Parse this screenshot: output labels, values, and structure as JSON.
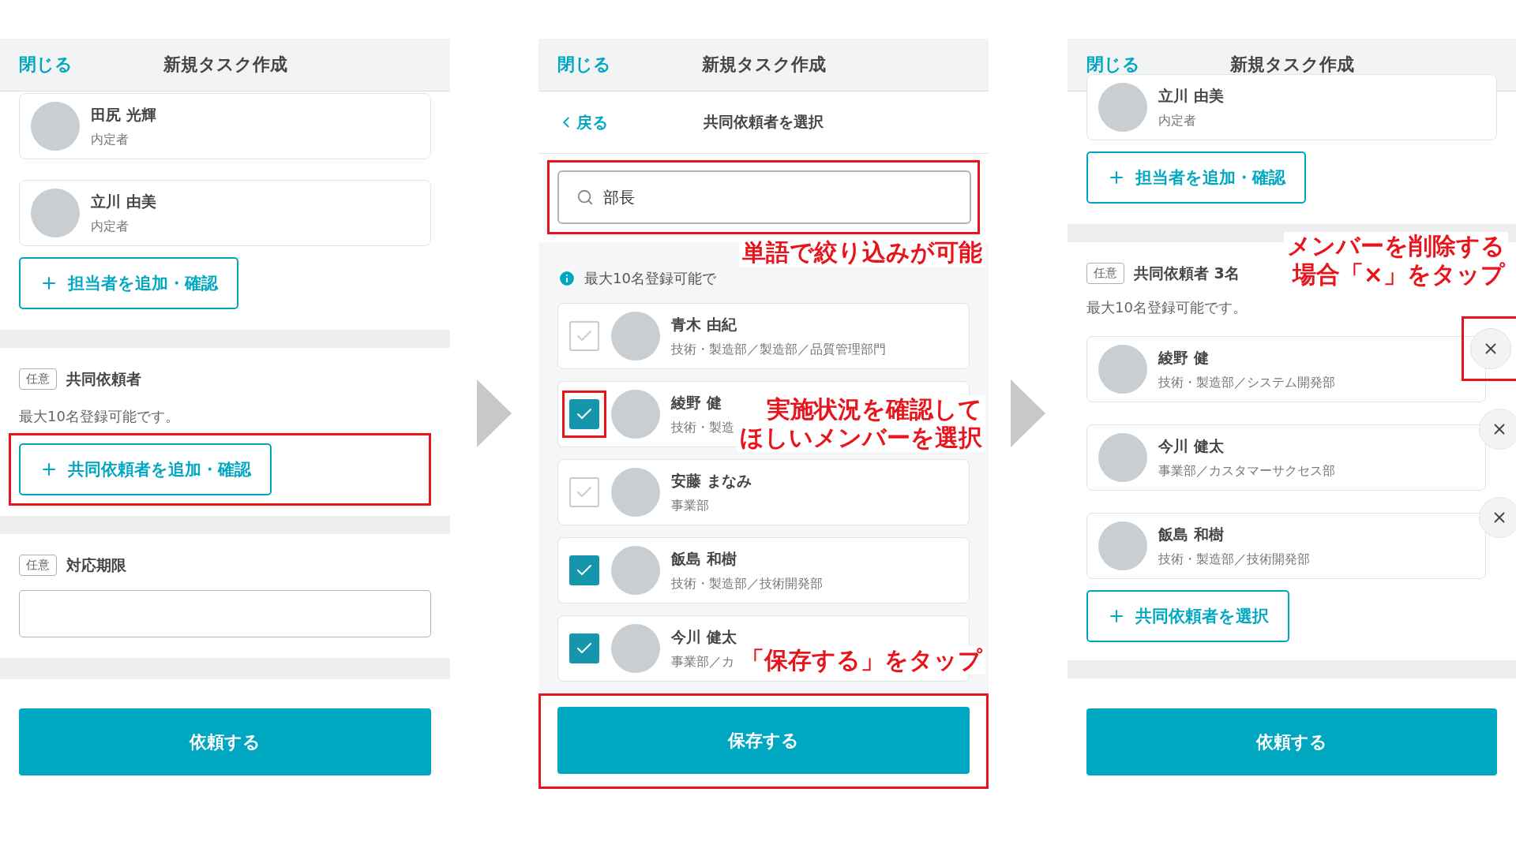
{
  "screens": [
    {
      "kind": "form",
      "header": {
        "close": "閉じる",
        "title": "新規タスク作成"
      },
      "assignees": [
        {
          "name": "田尻 光輝",
          "role": "内定者"
        },
        {
          "name": "立川 由美",
          "role": "内定者"
        }
      ],
      "add_assignee": {
        "label": "担当者を追加・確認"
      },
      "co_requesters": {
        "tag": "任意",
        "title": "共同依頼者",
        "note": "最大10名登録可能です。",
        "add_button": {
          "label": "共同依頼者を追加・確認",
          "highlighted": true
        }
      },
      "deadline": {
        "tag": "任意",
        "title": "対応期限"
      },
      "submit": {
        "label": "依頼する"
      }
    },
    {
      "kind": "picker",
      "header": {
        "close": "閉じる",
        "title": "新規タスク作成"
      },
      "back": "戻る",
      "subtitle": "共同依頼者を選択",
      "search": {
        "value": "部長",
        "highlighted": true
      },
      "info": "最大10名登録可能で",
      "candidates": [
        {
          "name": "青木 由紀",
          "dept": "技術・製造部／製造部／品質管理部門",
          "checked": false,
          "highlighted": false
        },
        {
          "name": "綾野 健",
          "dept": "技術・製造",
          "checked": true,
          "highlighted": true
        },
        {
          "name": "安藤 まなみ",
          "dept": "事業部",
          "checked": false,
          "highlighted": false
        },
        {
          "name": "飯島 和樹",
          "dept": "技術・製造部／技術開発部",
          "checked": true,
          "highlighted": false
        },
        {
          "name": "今川 健太",
          "dept": "事業部／カ",
          "checked": true,
          "highlighted": false
        }
      ],
      "save": {
        "label": "保存する",
        "highlighted": true
      },
      "annotations": [
        {
          "lines": [
            "単語で絞り込みが可能"
          ]
        },
        {
          "lines": [
            "実施状況を確認して",
            "ほしいメンバーを選択"
          ]
        },
        {
          "lines": [
            "「保存する」をタップ"
          ]
        }
      ]
    },
    {
      "kind": "form",
      "header": {
        "close": "閉じる",
        "title": "新規タスク作成"
      },
      "assignees": [
        {
          "name": "立川 由美",
          "role": "内定者"
        }
      ],
      "add_assignee": {
        "label": "担当者を追加・確認"
      },
      "co_requesters": {
        "tag": "任意",
        "title": "共同依頼者 3名",
        "note": "最大10名登録可能です。",
        "members": [
          {
            "name": "綾野 健",
            "dept": "技術・製造部／システム開発部",
            "highlighted": true
          },
          {
            "name": "今川 健太",
            "dept": "事業部／カスタマーサクセス部",
            "highlighted": false
          },
          {
            "name": "飯島 和樹",
            "dept": "技術・製造部／技術開発部",
            "highlighted": false
          }
        ],
        "add_button": {
          "label": "共同依頼者を選択",
          "highlighted": false
        }
      },
      "submit": {
        "label": "依頼する"
      },
      "annotations": [
        {
          "lines": [
            "メンバーを削除する",
            "場合「×」をタップ"
          ]
        }
      ]
    }
  ]
}
